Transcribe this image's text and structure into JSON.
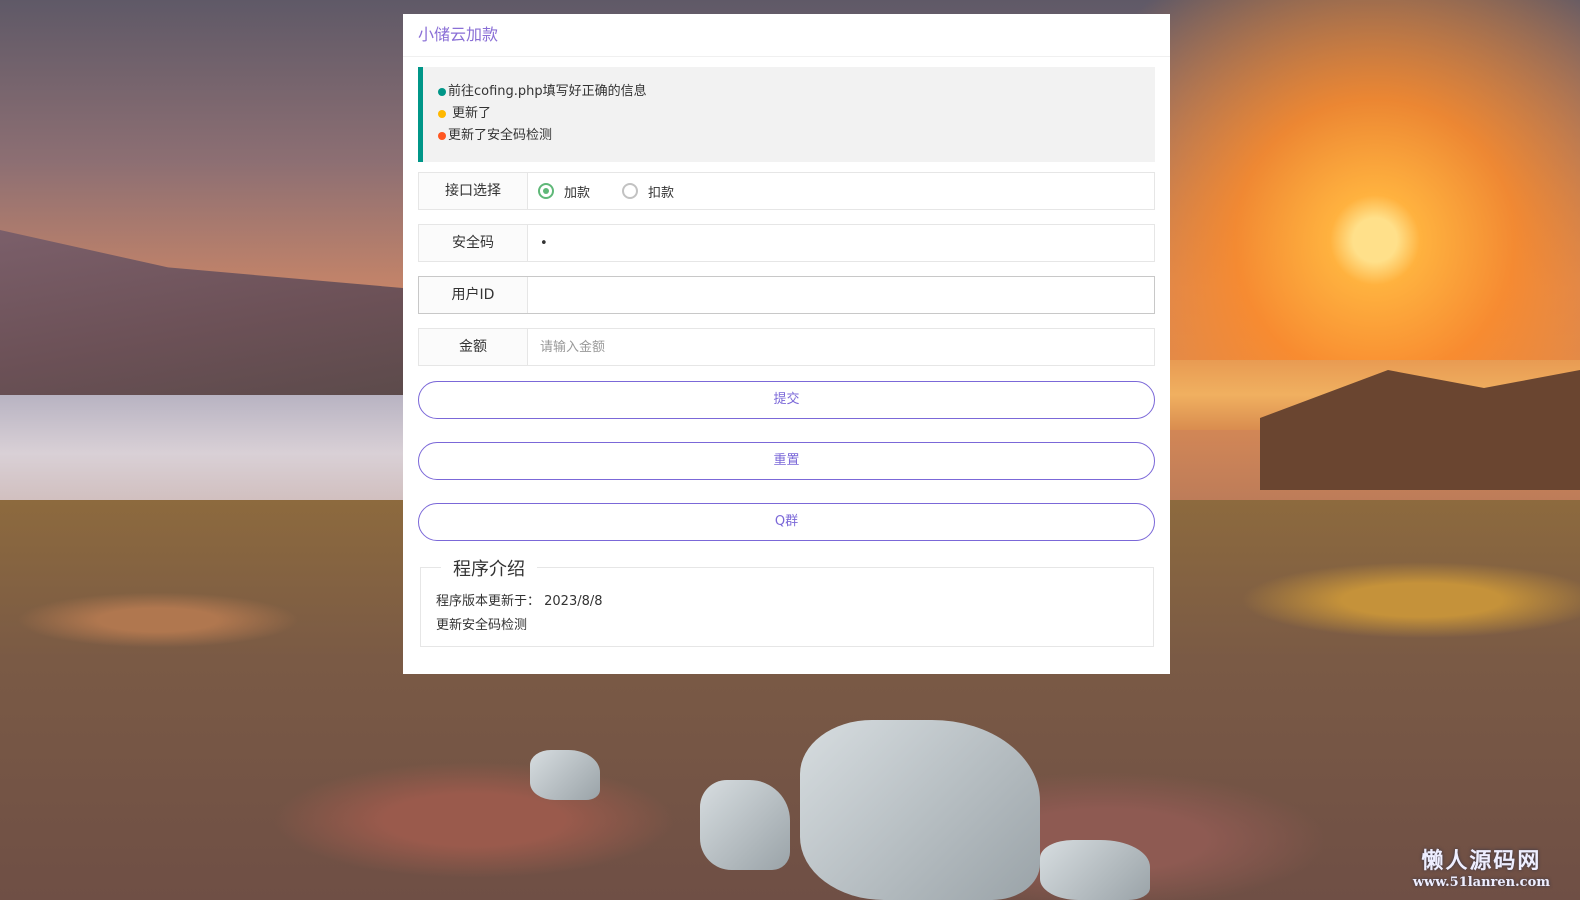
{
  "panel": {
    "title": "小储云加款",
    "notices": [
      {
        "text": "前往cofing.php填写好正确的信息",
        "dot_color": "#009688"
      },
      {
        "text": "更新了",
        "dot_color": "#FFB800"
      },
      {
        "text": "更新了安全码检测",
        "dot_color": "#FF5722"
      }
    ],
    "interface": {
      "label": "接口选择",
      "options": [
        {
          "label": "加款",
          "selected": true
        },
        {
          "label": "扣款",
          "selected": false
        }
      ]
    },
    "security_code": {
      "label": "安全码",
      "value": "•"
    },
    "user_id": {
      "label": "用户ID",
      "value": "",
      "placeholder": ""
    },
    "amount": {
      "label": "金额",
      "value": "",
      "placeholder": "请输入金额"
    },
    "buttons": {
      "submit": "提交",
      "reset": "重置",
      "qgroup": "Q群"
    },
    "intro": {
      "legend": "程序介绍",
      "version_text": "程序版本更新于： 2023/8/8",
      "update_text": "更新安全码检测"
    },
    "accent_color": "#7b68d8"
  },
  "watermark": {
    "title": "懒人源码网",
    "url": "www.51lanren.com"
  }
}
